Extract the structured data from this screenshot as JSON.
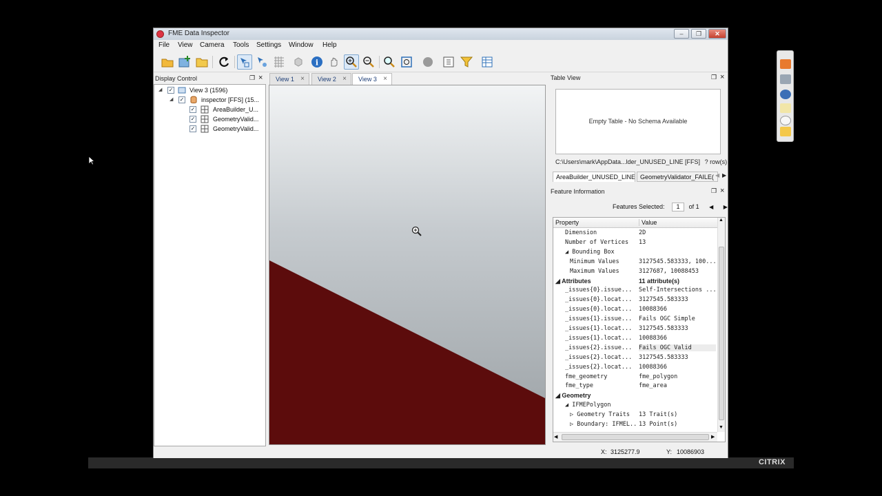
{
  "window": {
    "title": "FME Data Inspector"
  },
  "menu": [
    "File",
    "View",
    "Camera",
    "Tools",
    "Settings",
    "Window",
    "Help"
  ],
  "toolbar": {
    "buttons": [
      "open-folder",
      "add-dataset",
      "folder",
      "refresh",
      "select",
      "select-multiple",
      "grid",
      "hidden-tool",
      "info",
      "pan",
      "zoom-in",
      "zoom-out",
      "zoom-to-selection",
      "zoom-extents",
      "stop",
      "properties",
      "filter",
      "table"
    ],
    "active": [
      "select",
      "zoom-in"
    ]
  },
  "display_control": {
    "title": "Display Control",
    "items": [
      {
        "label": "View 3 (1596)"
      },
      {
        "label": "inspector [FFS] (15..."
      },
      {
        "label": "AreaBuilder_U..."
      },
      {
        "label": "GeometryValid..."
      },
      {
        "label": "GeometryValid..."
      }
    ]
  },
  "view_tabs": [
    {
      "label": "View 1"
    },
    {
      "label": "View 2"
    },
    {
      "label": "View 3"
    }
  ],
  "active_view": "View 3",
  "map": {
    "feature_color": "#5c0c0c",
    "background_top": "#f2f4f5",
    "background_bottom": "#9aa0a4"
  },
  "table_view": {
    "title": "Table View",
    "empty_message": "Empty Table - No Schema Available",
    "path": "C:\\Users\\mark\\AppData...lder_UNUSED_LINE [FFS]",
    "rows": "? row(s)",
    "tabs": [
      "AreaBuilder_UNUSED_LINE",
      "GeometryValidator_FAILE("
    ]
  },
  "feature_info": {
    "title": "Feature Information",
    "features_selected_label": "Features Selected:",
    "current": "1",
    "of_label": "of 1",
    "columns": {
      "property": "Property",
      "value": "Value"
    },
    "rows": [
      {
        "property": "Dimension",
        "value": "2D",
        "indent": 1
      },
      {
        "property": "Number of Vertices",
        "value": "13",
        "indent": 1
      },
      {
        "property": "◢ Bounding Box",
        "value": "",
        "indent": 1
      },
      {
        "property": "Minimum Values",
        "value": "3127545.583333, 100...",
        "indent": 2
      },
      {
        "property": "Maximum Values",
        "value": "3127687, 10088453",
        "indent": 2
      },
      {
        "property": "◢ Attributes",
        "value": "11 attribute(s)",
        "indent": 0,
        "section": true
      },
      {
        "property": "_issues{0}.issue...",
        "value": "Self-Intersections ...",
        "indent": 1
      },
      {
        "property": "_issues{0}.locat...",
        "value": "3127545.583333",
        "indent": 1
      },
      {
        "property": "_issues{0}.locat...",
        "value": "10088366",
        "indent": 1
      },
      {
        "property": "_issues{1}.issue...",
        "value": "Fails OGC Simple",
        "indent": 1
      },
      {
        "property": "_issues{1}.locat...",
        "value": "3127545.583333",
        "indent": 1
      },
      {
        "property": "_issues{1}.locat...",
        "value": "10088366",
        "indent": 1
      },
      {
        "property": "_issues{2}.issue...",
        "value": "Fails OGC Valid",
        "indent": 1,
        "highlight": true
      },
      {
        "property": "_issues{2}.locat...",
        "value": "3127545.583333",
        "indent": 1
      },
      {
        "property": "_issues{2}.locat...",
        "value": "10088366",
        "indent": 1
      },
      {
        "property": "fme_geometry",
        "value": "fme_polygon",
        "indent": 1
      },
      {
        "property": "fme_type",
        "value": "fme_area",
        "indent": 1
      },
      {
        "property": "◢ Geometry",
        "value": "",
        "indent": 0,
        "section": true
      },
      {
        "property": "◢ IFMEPolygon",
        "value": "",
        "indent": 1
      },
      {
        "property": "▷ Geometry Traits",
        "value": "13 Trait(s)",
        "indent": 2
      },
      {
        "property": "▷ Boundary: IFMEL...",
        "value": "13 Point(s)",
        "indent": 2
      }
    ]
  },
  "status": {
    "x_label": "X:",
    "x_value": "3125277.9",
    "y_label": "Y:",
    "y_value": "10086903"
  },
  "citrix": {
    "logo": "CITRIX"
  }
}
